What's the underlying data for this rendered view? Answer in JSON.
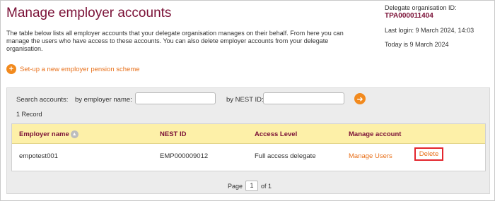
{
  "header": {
    "title": "Manage employer accounts",
    "delegate_label": "Delegate organisation ID:",
    "delegate_id": "TPA000011404",
    "last_login": "Last login: 9 March 2024, 14:03",
    "today": "Today is 9 March 2024"
  },
  "intro": "The table below lists all employer accounts that your delegate organisation manages on their behalf. From here you can manage the users who have access to these accounts. You can also delete employer accounts from your delegate organisation.",
  "setup_link": "Set-up a new employer pension scheme",
  "search": {
    "label": "Search accounts:",
    "by_name_label": "by employer name:",
    "by_id_label": "by NEST ID:",
    "name_value": "",
    "id_value": ""
  },
  "record_count": "1 Record",
  "table": {
    "headers": [
      "Employer name",
      "NEST ID",
      "Access Level",
      "Manage account"
    ],
    "rows": [
      {
        "employer": "empotest001",
        "nest_id": "EMP000009012",
        "access": "Full access delegate",
        "manage": "Manage Users",
        "delete": "Delete"
      }
    ]
  },
  "pager": {
    "page_label": "Page",
    "current": "1",
    "of_label": "of 1"
  },
  "icons": {
    "add": "plus-circle-icon",
    "go": "arrow-right-circle-icon",
    "sort": "sort-icon"
  },
  "colors": {
    "title": "#7a1036",
    "accent": "#f28a1e",
    "header_bg": "#fdf0a8",
    "highlight": "#e3262d"
  }
}
